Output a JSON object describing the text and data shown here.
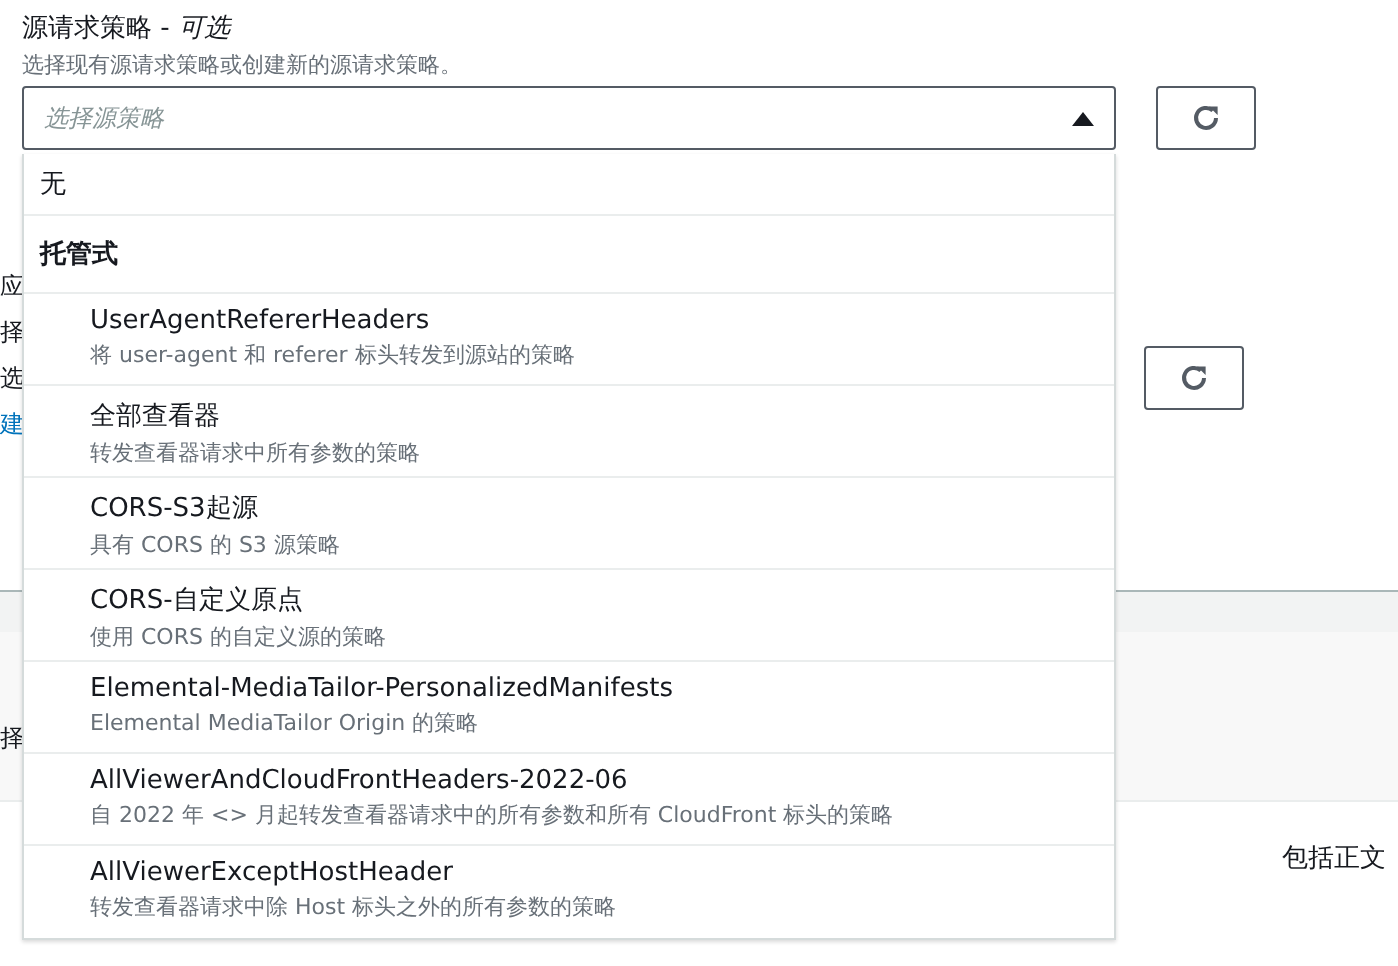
{
  "field": {
    "label": "源请求策略 - *可选*",
    "description": "选择现有源请求策略或创建新的源请求策略。",
    "placeholder": "选择源策略",
    "expanded": true
  },
  "options": [
    {
      "kind": "option",
      "label": "无"
    },
    {
      "kind": "group",
      "label": "托管式"
    },
    {
      "kind": "policy",
      "name": "UserAgentRefererHeaders",
      "description": "将 user-agent 和 referer 标头转发到源站的策略"
    },
    {
      "kind": "policy",
      "name": "全部查看器",
      "description": "转发查看器请求中所有参数的策略"
    },
    {
      "kind": "policy",
      "name": "CORS-S3起源",
      "description": "具有 CORS 的 S3 源策略"
    },
    {
      "kind": "policy",
      "name": "CORS-自定义原点",
      "description": "使用 CORS 的自定义源的策略"
    },
    {
      "kind": "policy",
      "name": "Elemental-MediaTailor-PersonalizedManifests",
      "description": "Elemental MediaTailor Origin 的策略"
    },
    {
      "kind": "policy",
      "name": "AllViewerAndCloudFrontHeaders-2022-06",
      "description": "自 2022 年 <> 月起转发查看器请求中的所有参数和所有 CloudFront 标头的策略"
    },
    {
      "kind": "policy",
      "name": "AllViewerExceptHostHeader",
      "description": "转发查看器请求中除 Host 标头之外的所有参数的策略"
    }
  ],
  "background": {
    "fragments": [
      {
        "kind": "text",
        "text": "应"
      },
      {
        "kind": "text",
        "text": "择"
      },
      {
        "kind": "text",
        "text": "选"
      },
      {
        "kind": "link",
        "text": "建"
      }
    ],
    "band_fragment": "择",
    "right_text": "包括正文"
  }
}
